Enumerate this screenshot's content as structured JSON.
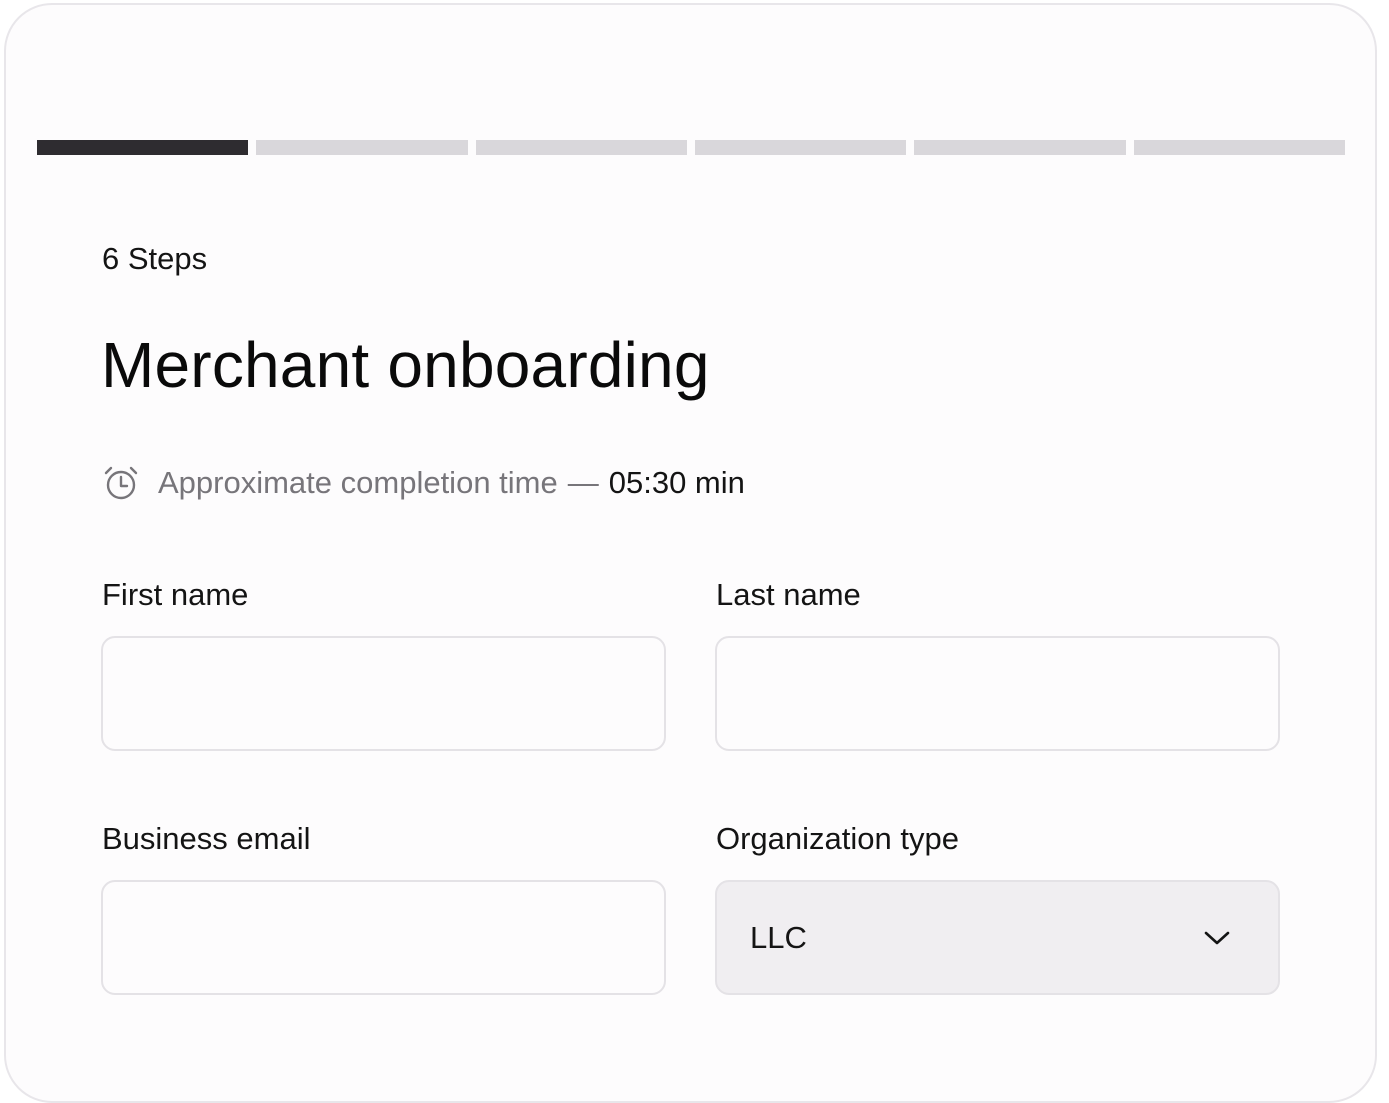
{
  "progress": {
    "total_steps": 6,
    "current_step": 1
  },
  "header": {
    "steps_label": "6 Steps",
    "title": "Merchant onboarding"
  },
  "completion": {
    "icon": "alarm-clock-icon",
    "label": "Approximate completion time",
    "separator": "—",
    "value": "05:30 min"
  },
  "form": {
    "first_name": {
      "label": "First name",
      "value": ""
    },
    "last_name": {
      "label": "Last name",
      "value": ""
    },
    "business_email": {
      "label": "Business email",
      "value": ""
    },
    "organization_type": {
      "label": "Organization type",
      "selected": "LLC",
      "icon": "chevron-down-icon"
    }
  },
  "colors": {
    "progress_done": "#2e2c30",
    "progress_pending": "#d9d7db",
    "select_bg": "#f0eef1",
    "muted_text": "#77757a"
  }
}
